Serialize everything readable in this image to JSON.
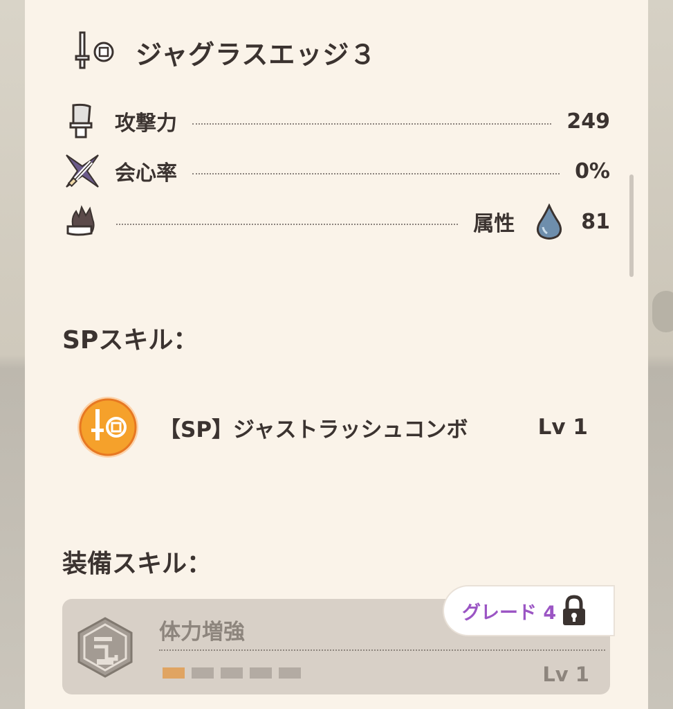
{
  "weapon": {
    "name": "ジャグラスエッジ３",
    "type_icon": "sword-and-shield-icon"
  },
  "stats": {
    "attack": {
      "label": "攻撃力",
      "value": "249",
      "icon": "attack-blade-icon"
    },
    "affinity": {
      "label": "会心率",
      "value": "0%",
      "icon": "affinity-crossed-swords-icon"
    },
    "element": {
      "label": "属性",
      "value": "81",
      "icon": "element-flame-blade-icon",
      "element_icon": "water-drop-icon"
    }
  },
  "sp_skills": {
    "title": "SPスキル：",
    "items": [
      {
        "name": "【SP】ジャストラッシュコンボ",
        "level": "Lv 1",
        "icon": "sword-and-shield-badge-icon"
      }
    ]
  },
  "equip_skills": {
    "title": "装備スキル：",
    "items": [
      {
        "name": "体力増強",
        "level": "Lv 1",
        "icon": "health-boost-hex-icon",
        "level_fill": 1,
        "level_max": 5,
        "locked_grade": "グレード 4",
        "lock_icon": "padlock-icon"
      }
    ]
  },
  "colors": {
    "panel_bg": "#faf3e9",
    "text": "#3b3330",
    "sp_badge": "#f5a12b",
    "grade_text": "#9b55c4",
    "level_bar_on": "#e0a462",
    "card_bg": "#d8d0c7"
  }
}
